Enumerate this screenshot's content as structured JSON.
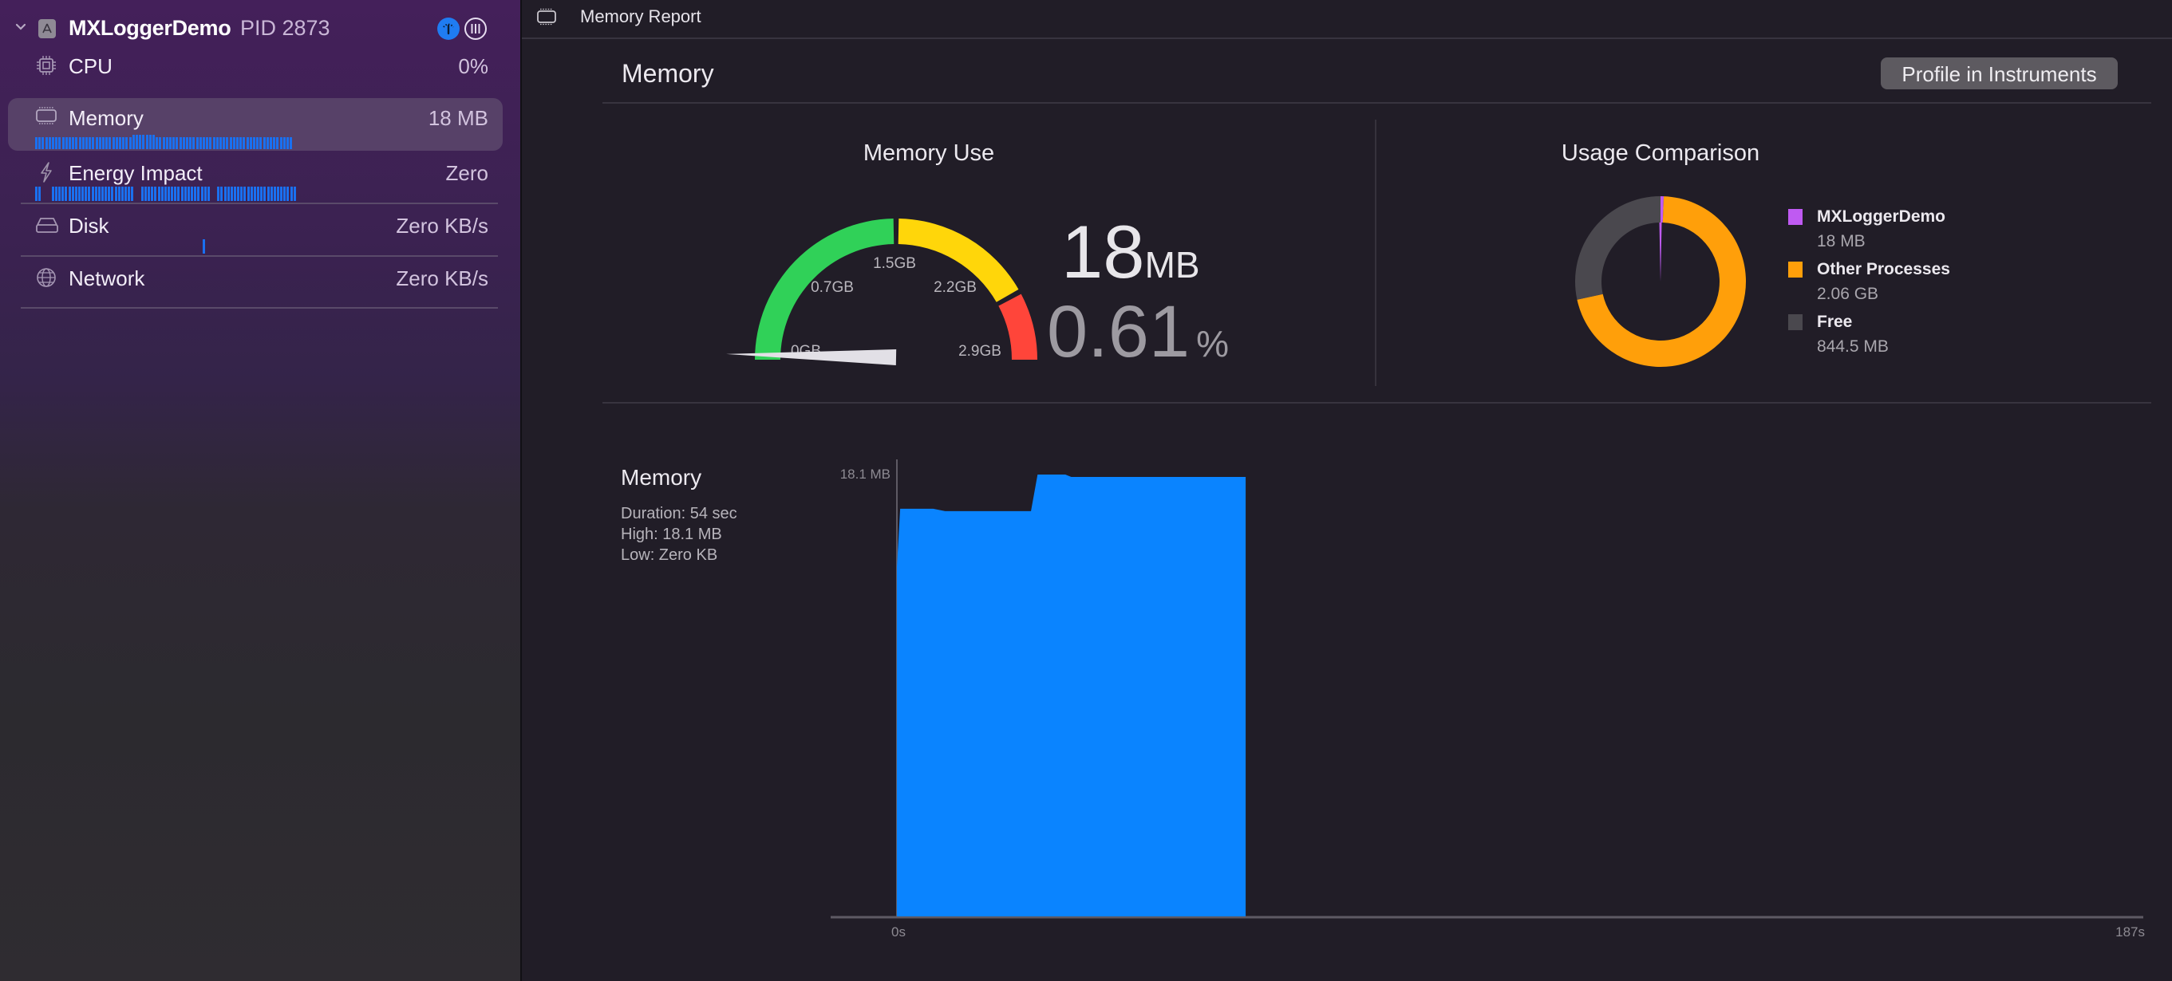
{
  "sidebar": {
    "process": {
      "name": "MXLoggerDemo",
      "pid_label": "PID 2873",
      "expanded": true,
      "icons": [
        "app-store-icon",
        "debug-gauges-icon",
        "pause-threads-icon"
      ]
    },
    "items": [
      {
        "label": "CPU",
        "value": "0%",
        "icon": "cpu-icon",
        "selected": false
      },
      {
        "label": "Memory",
        "value": "18 MB",
        "icon": "memory-chip-icon",
        "selected": true
      },
      {
        "label": "Energy Impact",
        "value": "Zero",
        "icon": "bolt-icon",
        "selected": false
      },
      {
        "label": "Disk",
        "value": "Zero KB/s",
        "icon": "disk-icon",
        "selected": false
      },
      {
        "label": "Network",
        "value": "Zero KB/s",
        "icon": "globe-icon",
        "selected": false
      }
    ],
    "accent_color": "#1a70f0"
  },
  "breadcrumb": {
    "label": "Memory Report",
    "icon": "memory-chip-icon"
  },
  "header": {
    "title": "Memory",
    "profile_button": "Profile in Instruments"
  },
  "memory_use": {
    "title": "Memory Use",
    "value": "18",
    "unit": "MB",
    "percent": "0.61",
    "percent_unit": "%",
    "gauge": {
      "min_gb": 0,
      "max_gb": 2.9,
      "value_gb": 0.018,
      "tick_labels": [
        "0GB",
        "0.7GB",
        "1.5GB",
        "2.2GB",
        "2.9GB"
      ],
      "segments": [
        {
          "from_fraction": 0.0,
          "to_fraction": 0.5,
          "color": "#30d158"
        },
        {
          "from_fraction": 0.5,
          "to_fraction": 0.84,
          "color": "#ffd60a"
        },
        {
          "from_fraction": 0.84,
          "to_fraction": 1.0,
          "color": "#ff453a"
        }
      ]
    }
  },
  "usage_comparison": {
    "title": "Usage Comparison",
    "legend": [
      {
        "name": "MXLoggerDemo",
        "value": "18 MB",
        "color": "#bf5af2"
      },
      {
        "name": "Other Processes",
        "value": "2.06 GB",
        "color": "#ff9f0a"
      },
      {
        "name": "Free",
        "value": "844.5 MB",
        "color": "#4a484e"
      }
    ]
  },
  "history": {
    "title": "Memory",
    "stats": [
      "Duration: 54 sec",
      "High: 18.1 MB",
      "Low: Zero KB"
    ]
  },
  "chart_data": [
    {
      "type": "pie",
      "title": "Usage Comparison",
      "categories": [
        "MXLoggerDemo",
        "Other Processes",
        "Free"
      ],
      "values": [
        18,
        2109.4,
        844.5
      ],
      "unit": "MB",
      "donut": true,
      "colors": [
        "#bf5af2",
        "#ff9f0a",
        "#4a484e"
      ],
      "legend": "right"
    },
    {
      "type": "area",
      "title": "Memory",
      "xlabel": "",
      "ylabel": "",
      "x_unit": "s",
      "y_unit": "MB",
      "xlim": [
        0,
        187
      ],
      "ylim": [
        0,
        18.1
      ],
      "x_tick_labels": [
        "0s",
        "187s"
      ],
      "y_tick_labels": [
        "18.1 MB"
      ],
      "color": "#0a84ff",
      "grid": false,
      "x": [
        0,
        0.5,
        5.5,
        7.3,
        20.3,
        21.3,
        25.5,
        26.4,
        52.8,
        52.8
      ],
      "y": [
        14.3,
        16.7,
        16.7,
        16.6,
        16.6,
        18.1,
        18.1,
        18.0,
        18.0,
        0
      ]
    },
    {
      "type": "bar",
      "title": "Memory Use gauge",
      "categories": [
        "MXLoggerDemo"
      ],
      "values": [
        0.018
      ],
      "unit": "GB",
      "ylim": [
        0,
        2.9
      ]
    }
  ]
}
